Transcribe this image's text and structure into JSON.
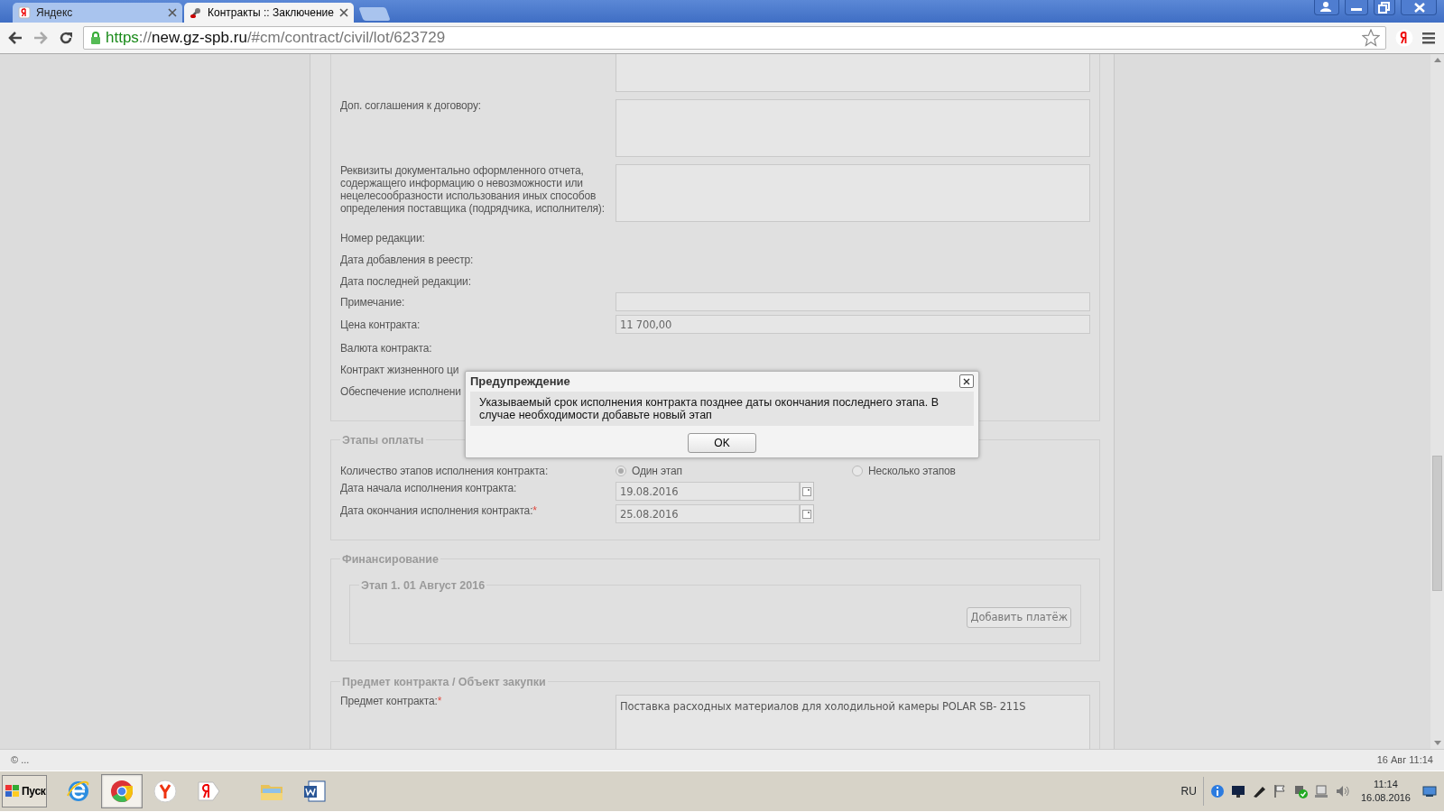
{
  "browser": {
    "tabs": [
      {
        "label": "Яндекс",
        "kind": "yandex",
        "selected": false
      },
      {
        "label": "Контракты :: Заключение",
        "kind": "tools",
        "selected": true
      }
    ],
    "url": {
      "scheme": "https",
      "separator": "://",
      "host": "new.gz-spb.ru",
      "path": "/#cm/contract/civil/lot/623729"
    }
  },
  "form": {
    "sections": [
      {
        "rows": [
          {
            "kind": "textarea"
          },
          {
            "kind": "textarea",
            "label": "Доп. соглашения к договору:"
          },
          {
            "kind": "textarea",
            "label": "Реквизиты документально оформленного отчета, содержащего информацию о невозможности или нецелесообразности использования иных способов определения поставщика (подрядчика, исполнителя):"
          },
          {
            "kind": "text",
            "label": "Номер редакции:"
          },
          {
            "kind": "text",
            "label": "Дата добавления в реестр:"
          },
          {
            "kind": "text",
            "label": "Дата последней редакции:"
          },
          {
            "kind": "input",
            "label": "Примечание:"
          },
          {
            "kind": "input",
            "label": "Цена контракта:",
            "value": "11 700,00"
          },
          {
            "kind": "text",
            "label": "Валюта контракта:"
          },
          {
            "kind": "text",
            "label": "Контракт жизненного ци"
          },
          {
            "kind": "text",
            "label": "Обеспечение исполнени"
          }
        ]
      },
      {
        "legend": "Этапы оплаты",
        "rows": [
          {
            "kind": "radio",
            "label": "Количество этапов исполнения контракта:",
            "options": [
              {
                "label": "Один этап",
                "selected": true
              },
              {
                "label": "Несколько этапов",
                "selected": false
              }
            ]
          },
          {
            "kind": "date",
            "label": "Дата начала исполнения контракта:",
            "value": "19.08.2016"
          },
          {
            "kind": "date",
            "label": "Дата окончания исполнения контракта:",
            "required_mark": "*",
            "value": "25.08.2016"
          }
        ]
      },
      {
        "legend": "Финансирование",
        "stages": [
          {
            "legend": "Этап 1. 01 Август 2016",
            "button": "Добавить платёж"
          }
        ]
      },
      {
        "legend": "Предмет контракта / Объект закупки",
        "rows": [
          {
            "kind": "textarea",
            "label": "Предмет контракта:",
            "required_mark": "*",
            "value": "Поставка расходных материалов для холодильной камеры POLAR SB- 211S"
          }
        ]
      }
    ]
  },
  "dialog": {
    "title": "Предупреждение",
    "message": "Указываемый срок исполнения контракта позднее даты окончания последнего этапа. В случае необходимости добавьте новый этап",
    "button": "OK"
  },
  "status_bar": {
    "left": "© ...",
    "right": "16 Авг 11:14"
  },
  "taskbar": {
    "start": "Пуск",
    "apps": [
      {
        "kind": "ie",
        "selected": false
      },
      {
        "kind": "chrome",
        "selected": true
      },
      {
        "kind": "yabrowser",
        "selected": false
      },
      {
        "kind": "yandex",
        "selected": false
      },
      {
        "kind": "folder",
        "selected": false
      },
      {
        "kind": "word",
        "selected": false
      }
    ],
    "language": "RU",
    "time": "11:14",
    "date": "16.08.2016"
  }
}
